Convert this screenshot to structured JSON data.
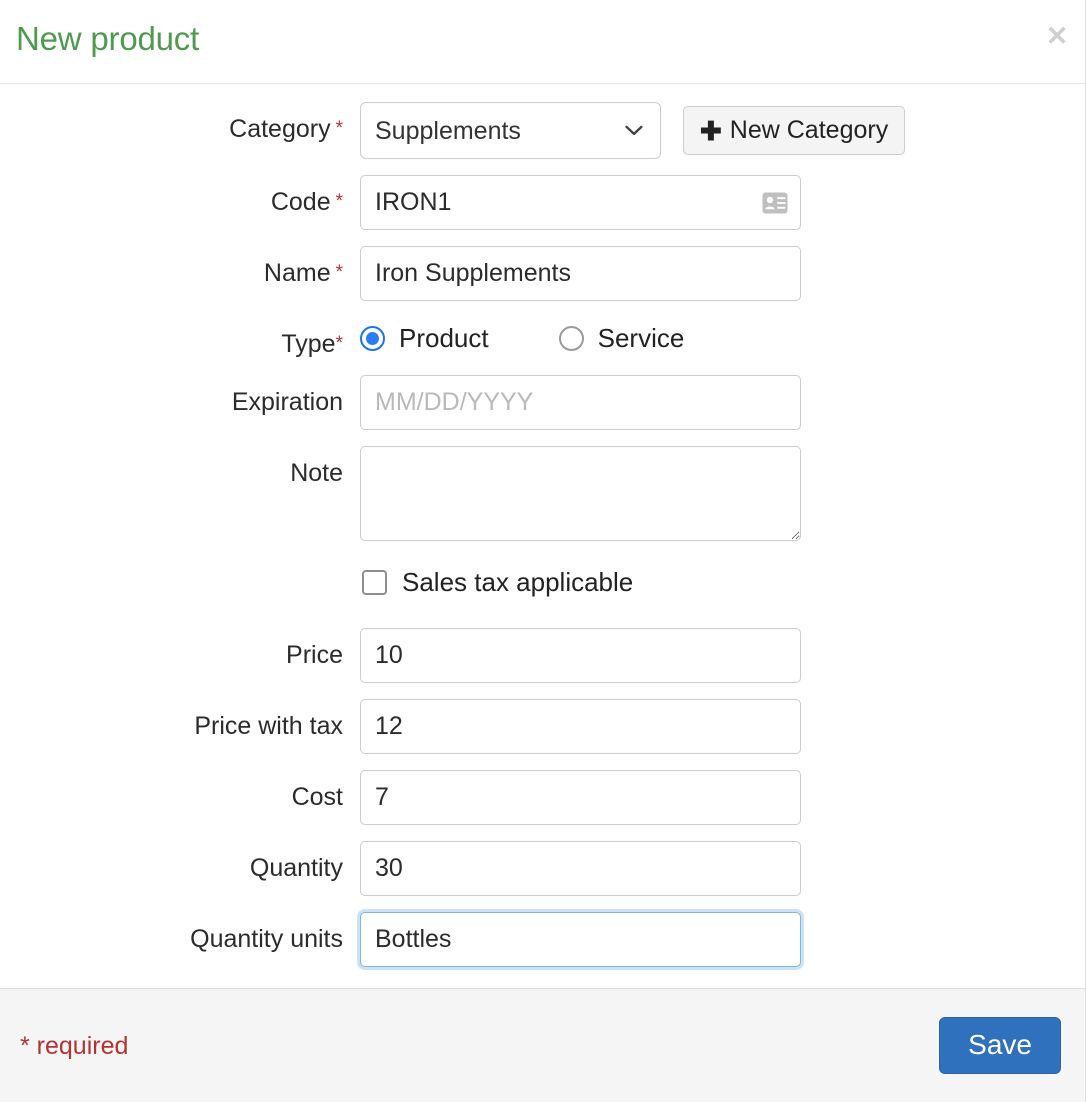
{
  "dialog": {
    "title": "New product",
    "close_label": "✕"
  },
  "form": {
    "category": {
      "label": "Category",
      "required_marker": "*",
      "selected": "Supplements",
      "options": [
        "Supplements"
      ],
      "new_button": "New Category",
      "new_button_icon": "plus-icon"
    },
    "code": {
      "label": "Code",
      "required_marker": "*",
      "value": "IRON1",
      "icon": "id-card-icon"
    },
    "name": {
      "label": "Name",
      "required_marker": "*",
      "value": "Iron Supplements"
    },
    "type": {
      "label": "Type",
      "required_marker": "*",
      "options": [
        {
          "label": "Product",
          "selected": true
        },
        {
          "label": "Service",
          "selected": false
        }
      ]
    },
    "expiration": {
      "label": "Expiration",
      "value": "",
      "placeholder": "MM/DD/YYYY"
    },
    "note": {
      "label": "Note",
      "value": ""
    },
    "sales_tax": {
      "label": "Sales tax applicable",
      "checked": false
    },
    "price": {
      "label": "Price",
      "value": "10"
    },
    "price_with_tax": {
      "label": "Price with tax",
      "value": "12"
    },
    "cost": {
      "label": "Cost",
      "value": "7"
    },
    "quantity": {
      "label": "Quantity",
      "value": "30"
    },
    "quantity_units": {
      "label": "Quantity units",
      "value": "Bottles",
      "focused": true
    }
  },
  "footer": {
    "required_note": "* required",
    "save_label": "Save"
  },
  "colors": {
    "title_green": "#4f9a4f",
    "required_red": "#b53131",
    "save_blue": "#3071bd",
    "radio_blue": "#2a7ff0",
    "focus_blue": "#80b6e0",
    "footer_bg": "#f5f5f5"
  }
}
